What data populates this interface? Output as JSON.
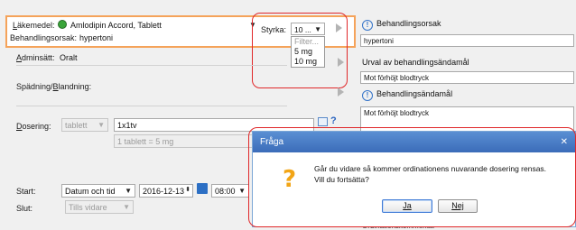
{
  "medication": {
    "label": "Läkemedel:",
    "value": "Amlodipin Accord, Tablett",
    "reason_label": "Behandlingsorsak:",
    "reason_value": "hypertoni"
  },
  "strength": {
    "label": "Styrka:",
    "value": "10 ...",
    "filter_placeholder": "Filter...",
    "options": [
      "5 mg",
      "10 mg"
    ]
  },
  "admin": {
    "label": "Adminsätt:",
    "value": "Oralt"
  },
  "dilution": {
    "label": "Spädning/Blandning:"
  },
  "dosage": {
    "label": "Dosering:",
    "unit": "tablett",
    "value": "1x1tv",
    "conversion": "1 tablett = 5 mg"
  },
  "schedule": {
    "start_label": "Start:",
    "start_mode": "Datum och tid",
    "start_date": "2016-12-13",
    "start_time": "08:00",
    "end_label": "Slut:",
    "end_mode": "Tills vidare"
  },
  "right_panel": {
    "reason_title": "Behandlingsorsak",
    "reason_value": "hypertoni",
    "purpose_selection_label": "Urval av behandlingsändamål",
    "purpose_selection_value": "Mot förhöjt blodtryck",
    "purpose_title": "Behandlingsändamål",
    "purpose_value": "Mot förhöjt blodtryck",
    "bottom_label": "Ordinationskommentar"
  },
  "dialog": {
    "title": "Fråga",
    "message_line1": "Går du vidare så kommer ordinationens nuvarande dosering rensas.",
    "message_line2": "Vill du fortsätta?",
    "yes_label": "Ja",
    "no_label": "Nej",
    "close_symbol": "✕"
  },
  "colors": {
    "accent_orange": "#f5a35a",
    "annotation_red": "#e0282a",
    "dialog_title_blue": "#4a7ec7",
    "question_orange": "#f2a516"
  }
}
